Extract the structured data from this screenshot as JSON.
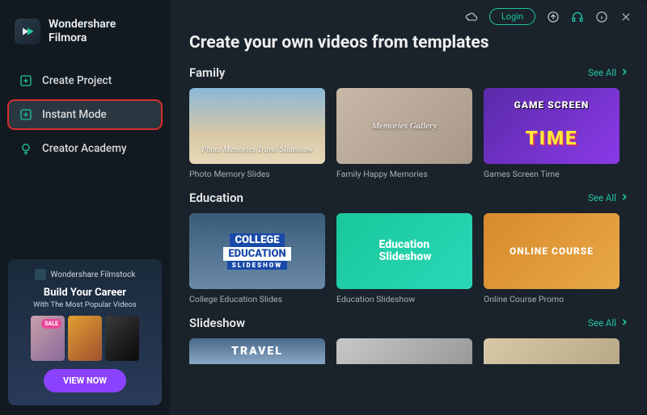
{
  "brand": {
    "line1": "Wondershare",
    "line2": "Filmora"
  },
  "nav": {
    "create_project": "Create Project",
    "instant_mode": "Instant Mode",
    "creator_academy": "Creator Academy"
  },
  "promo": {
    "brand": "Wondershare Filmstock",
    "title": "Build Your Career",
    "subtitle": "With The Most Popular Videos",
    "sale_badge": "SALE",
    "button": "VIEW NOW"
  },
  "titlebar": {
    "login": "Login"
  },
  "page": {
    "title": "Create your own videos from templates"
  },
  "see_all_label": "See All",
  "sections": {
    "family": {
      "title": "Family",
      "cards": [
        {
          "label": "Photo Memory Slides",
          "overlay": "Photo Memories Travel Slideshow"
        },
        {
          "label": "Family Happy Memories",
          "overlay": "Memories Gallery"
        },
        {
          "label": "Games Screen Time",
          "overlay1": "GAME SCREEN",
          "overlay2": "TIME"
        }
      ]
    },
    "education": {
      "title": "Education",
      "cards": [
        {
          "label": "College Education Slides",
          "l1": "COLLEGE",
          "l2": "EDUCATION",
          "l3": "SLIDESHOW"
        },
        {
          "label": "Education Slideshow",
          "overlay": "Education\nSlideshow"
        },
        {
          "label": "Online Course Promo",
          "overlay": "ONLINE COURSE"
        }
      ]
    },
    "slideshow": {
      "title": "Slideshow",
      "cards": [
        {
          "overlay": "TRAVEL"
        },
        {
          "overlay": ""
        },
        {
          "overlay": ""
        }
      ]
    }
  }
}
